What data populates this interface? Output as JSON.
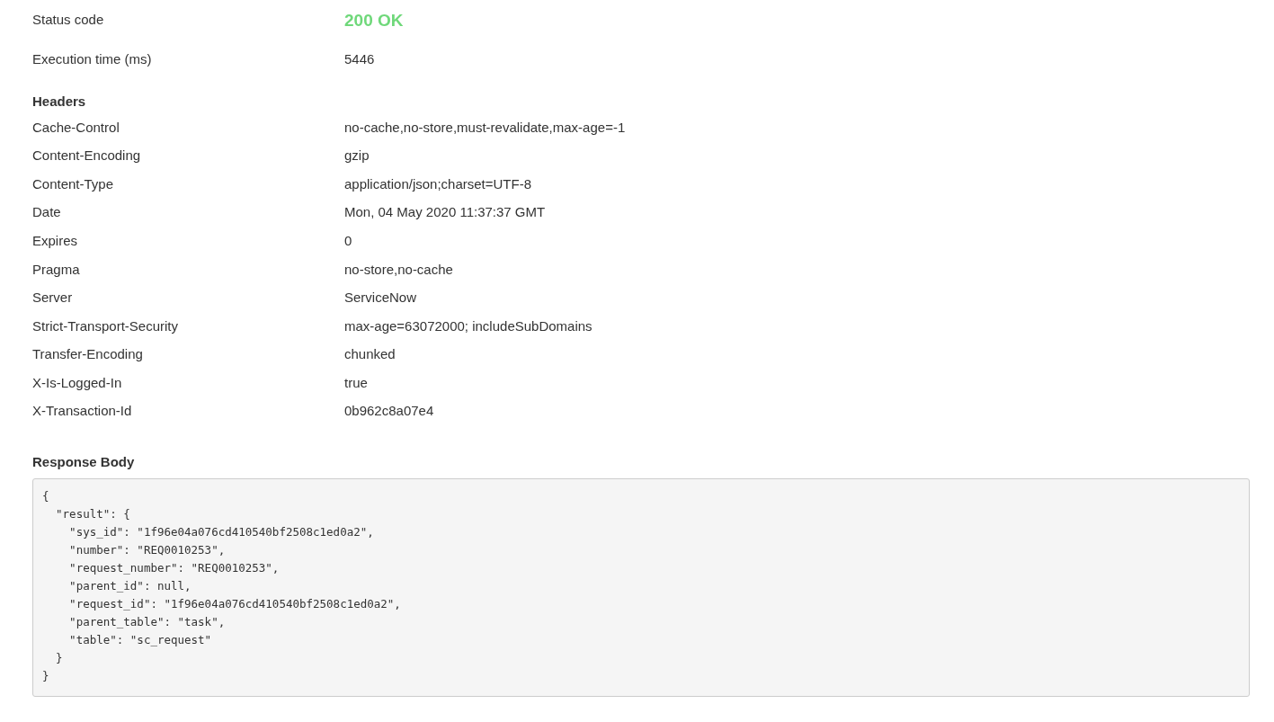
{
  "status": {
    "label": "Status code",
    "value": "200 OK"
  },
  "execution_time": {
    "label": "Execution time (ms)",
    "value": "5446"
  },
  "headers": {
    "title": "Headers",
    "rows": [
      {
        "name": "Cache-Control",
        "value": "no-cache,no-store,must-revalidate,max-age=-1"
      },
      {
        "name": "Content-Encoding",
        "value": "gzip"
      },
      {
        "name": "Content-Type",
        "value": "application/json;charset=UTF-8"
      },
      {
        "name": "Date",
        "value": "Mon, 04 May 2020 11:37:37 GMT"
      },
      {
        "name": "Expires",
        "value": "0"
      },
      {
        "name": "Pragma",
        "value": "no-store,no-cache"
      },
      {
        "name": "Server",
        "value": "ServiceNow"
      },
      {
        "name": "Strict-Transport-Security",
        "value": "max-age=63072000; includeSubDomains"
      },
      {
        "name": "Transfer-Encoding",
        "value": "chunked"
      },
      {
        "name": "X-Is-Logged-In",
        "value": "true"
      },
      {
        "name": "X-Transaction-Id",
        "value": "0b962c8a07e4"
      }
    ]
  },
  "response_body": {
    "title": "Response Body",
    "lines": [
      "{",
      "  \"result\": {",
      "    \"sys_id\": \"1f96e04a076cd410540bf2508c1ed0a2\",",
      "    \"number\": \"REQ0010253\",",
      "    \"request_number\": \"REQ0010253\",",
      "    \"parent_id\": null,",
      "    \"request_id\": \"1f96e04a076cd410540bf2508c1ed0a2\",",
      "    \"parent_table\": \"task\",",
      "    \"table\": \"sc_request\"",
      "  }",
      "}"
    ]
  }
}
